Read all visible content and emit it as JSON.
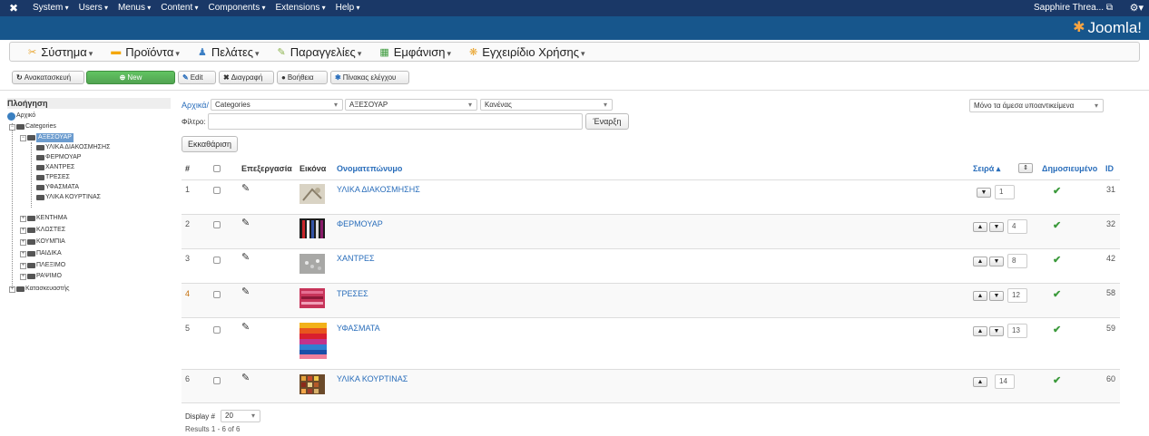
{
  "adminbar": {
    "menus": [
      "System",
      "Users",
      "Menus",
      "Content",
      "Components",
      "Extensions",
      "Help"
    ],
    "user": "Sapphire Threa...",
    "user_icon": "external-link-icon",
    "settings_icon": "gear-icon"
  },
  "header": {
    "brand": "Joomla!"
  },
  "compnav": {
    "items": [
      {
        "label": "Σύστημα",
        "icon": "wrench-icon",
        "color": "#e8a32a"
      },
      {
        "label": "Προϊόντα",
        "icon": "box-icon",
        "color": "#f4a700"
      },
      {
        "label": "Πελάτες",
        "icon": "users-icon",
        "color": "#3c7fc4"
      },
      {
        "label": "Παραγγελίες",
        "icon": "cart-icon",
        "color": "#8ab24a"
      },
      {
        "label": "Εμφάνιση",
        "icon": "layout-icon",
        "color": "#3c9a3c"
      },
      {
        "label": "Εγχειρίδιο Χρήσης",
        "icon": "help-icon",
        "color": "#e8a32a"
      }
    ]
  },
  "toolbar": {
    "restore": "Ανακατασκευή",
    "new": "New",
    "edit": "Edit",
    "delete": "Διαγραφή",
    "help": "Βοήθεια",
    "control_panel": "Πίνακας ελέγχου"
  },
  "sidebar": {
    "title": "Πλοήγηση",
    "home": "Αρχικό",
    "categories": "Categories",
    "selected": "ΑΞΕΣΟΥΑΡ",
    "children": [
      "ΥΛΙΚΑ ΔΙΑΚΟΣΜΗΣΗΣ",
      "ΦΕΡΜΟΥΑΡ",
      "ΧΑΝΤΡΕΣ",
      "ΤΡΕΣΕΣ",
      "ΥΦΑΣΜΑΤΑ",
      "ΥΛΙΚΑ ΚΟΥΡΤΙΝΑΣ"
    ],
    "siblings": [
      "ΚΕΝΤΗΜΑ",
      "ΚΛΩΣΤΕΣ",
      "ΚΟΥΜΠΙΑ",
      "ΠΑΙΔΙΚΑ",
      "ΠΛΕΞΙΜΟ",
      "ΡΑΨΙΜΟ"
    ],
    "manufacturer": "Κατασκευαστής"
  },
  "filters": {
    "crumb": "Αρχικά/",
    "select1": "Categories",
    "select2": "ΑΞΕΣΟΥΑΡ",
    "select3": "Κανένας",
    "right_select": "Μόνο τα άμεσα υποαντικείμενα",
    "filter_label": "Φίλτρο:",
    "go": "Έναρξη",
    "clear": "Εκκαθάριση"
  },
  "table": {
    "headers": {
      "num": "#",
      "edit": "Επεξεργασία",
      "image": "Εικόνα",
      "name": "Ονοματεπώνυμο",
      "order": "Σειρά",
      "order_icon": "sort-ascending-icon",
      "published": "Δημοσιευμένο",
      "id": "ID"
    },
    "rows": [
      {
        "num": "1",
        "name": "ΥΛΙΚΑ ΔΙΑΚΟΣΜΗΣΗΣ",
        "order": "1",
        "id": "31",
        "up": false,
        "down": true,
        "published": true
      },
      {
        "num": "2",
        "name": "ΦΕΡΜΟΥΑΡ",
        "order": "4",
        "id": "32",
        "up": true,
        "down": true,
        "published": true
      },
      {
        "num": "3",
        "name": "ΧΑΝΤΡΕΣ",
        "order": "8",
        "id": "42",
        "up": true,
        "down": true,
        "published": true
      },
      {
        "num": "4",
        "name": "ΤΡΕΣΕΣ",
        "order": "12",
        "id": "58",
        "up": true,
        "down": true,
        "published": true
      },
      {
        "num": "5",
        "name": "ΥΦΑΣΜΑΤΑ",
        "order": "13",
        "id": "59",
        "up": true,
        "down": true,
        "published": true
      },
      {
        "num": "6",
        "name": "ΥΛΙΚΑ ΚΟΥΡΤΙΝΑΣ",
        "order": "14",
        "id": "60",
        "up": true,
        "down": false,
        "published": true
      }
    ]
  },
  "footer": {
    "display_label": "Display #",
    "display_value": "20",
    "results": "Results 1 - 6 of 6"
  }
}
